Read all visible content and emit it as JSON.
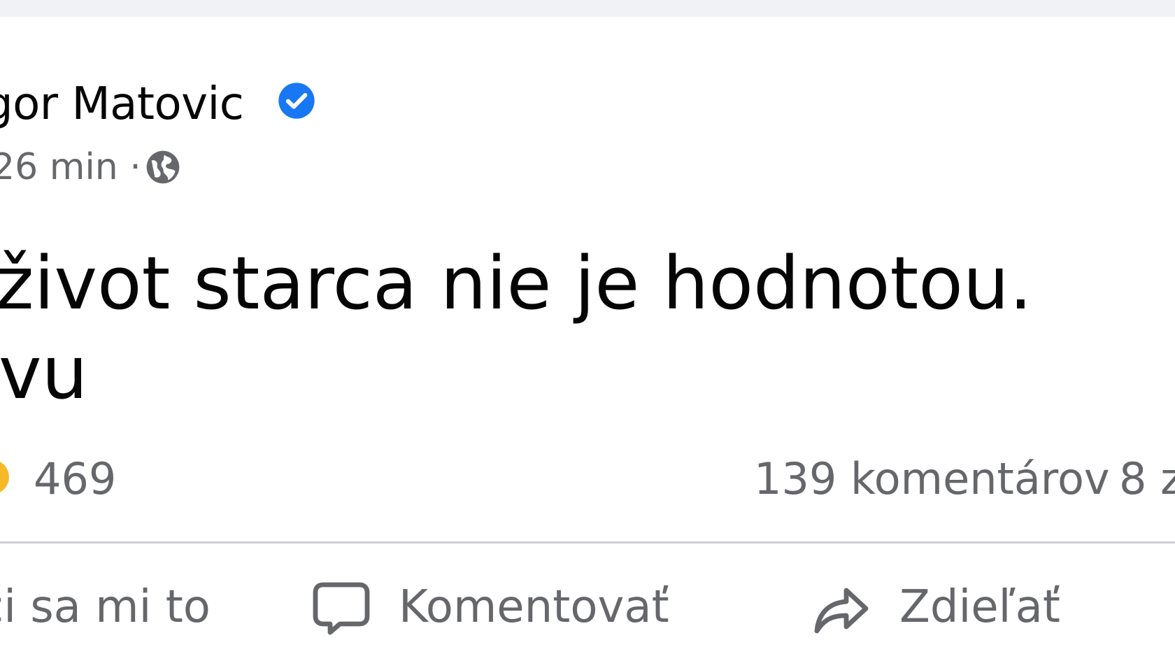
{
  "post": {
    "author": "gor Matovic",
    "time": "26 min",
    "separator": "·",
    "text_line1": "život starca nie je hodnotou.",
    "text_line2": "vu"
  },
  "stats": {
    "reactions": "469",
    "comments": "139 komentárov",
    "shares": "8 z"
  },
  "actions": {
    "like": "či sa mi to",
    "comment": "Komentovať",
    "share": "Zdieľať"
  },
  "icons": {
    "verified": "verified-badge-icon",
    "audience": "globe-icon",
    "reaction": "reaction-emoji-icon",
    "comment": "comment-icon",
    "share": "share-arrow-icon"
  },
  "colors": {
    "verified_blue": "#1877f2",
    "secondary_text": "#65676b",
    "primary_text": "#050505",
    "background": "#f0f2f5"
  }
}
